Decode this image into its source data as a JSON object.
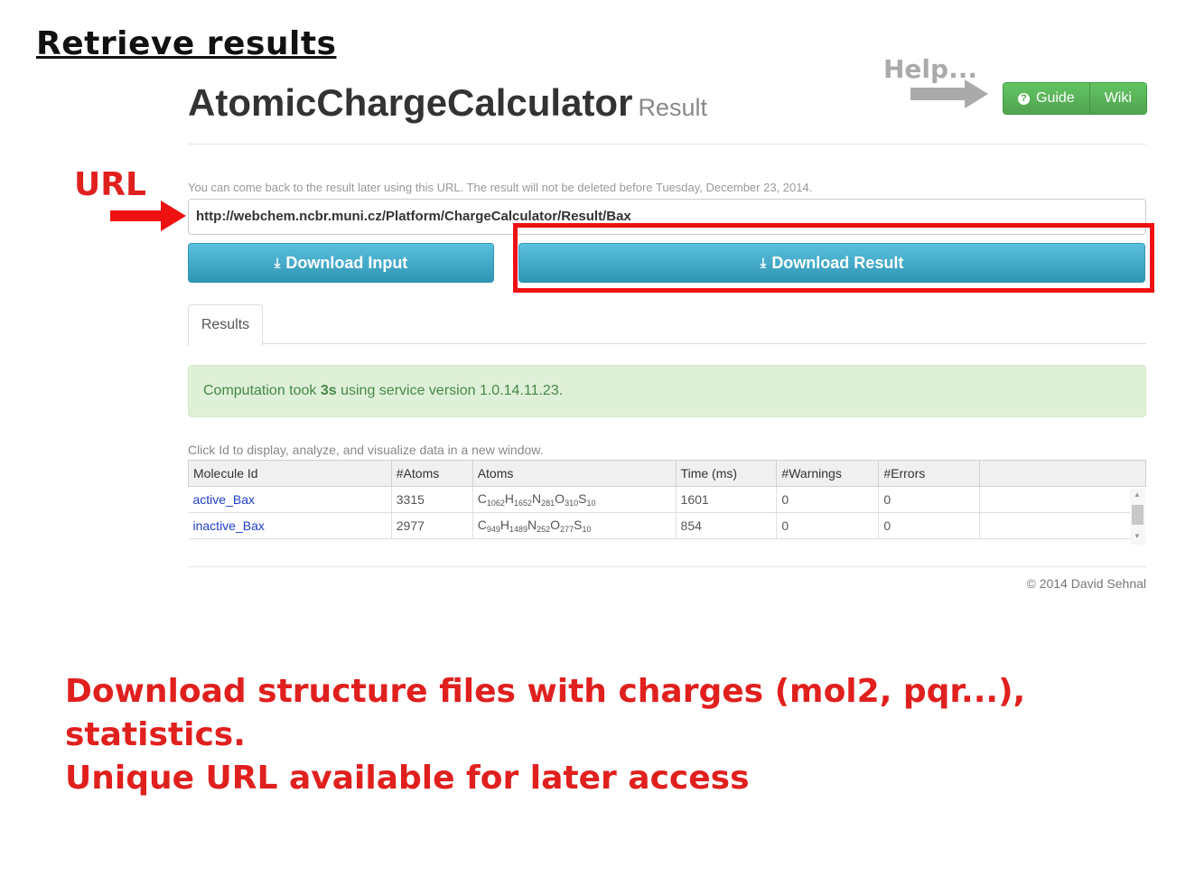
{
  "slide": {
    "title": "Retrieve results",
    "help_label": "Help...",
    "url_label": "URL",
    "caption_line1": "Download structure files with charges (mol2, pqr...), statistics.",
    "caption_line2": "Unique URL available for later access"
  },
  "header": {
    "app_name": "AtomicChargeCalculator",
    "page_label": "Result",
    "guide_label": "Guide",
    "wiki_label": "Wiki"
  },
  "result": {
    "info_text": "You can come back to the result later using this URL. The result will not be deleted before Tuesday, December 23, 2014.",
    "url": "http://webchem.ncbr.muni.cz/Platform/ChargeCalculator/Result/Bax",
    "download_input_label": "Download Input",
    "download_result_label": "Download Result"
  },
  "tabs": {
    "results_label": "Results"
  },
  "alert": {
    "prefix": "Computation took ",
    "time": "3s",
    "suffix": " using service version 1.0.14.11.23."
  },
  "table": {
    "hint": "Click Id to display, analyze, and visualize data in a new window.",
    "headers": [
      "Molecule Id",
      "#Atoms",
      "Atoms",
      "Time (ms)",
      "#Warnings",
      "#Errors"
    ],
    "rows": [
      {
        "id": "active_Bax",
        "atoms": "3315",
        "formula": [
          [
            "C",
            "1062"
          ],
          [
            "H",
            "1652"
          ],
          [
            "N",
            "281"
          ],
          [
            "O",
            "310"
          ],
          [
            "S",
            "10"
          ]
        ],
        "time": "1601",
        "warnings": "0",
        "errors": "0"
      },
      {
        "id": "inactive_Bax",
        "atoms": "2977",
        "formula": [
          [
            "C",
            "949"
          ],
          [
            "H",
            "1489"
          ],
          [
            "N",
            "252"
          ],
          [
            "O",
            "277"
          ],
          [
            "S",
            "10"
          ]
        ],
        "time": "854",
        "warnings": "0",
        "errors": "0"
      }
    ]
  },
  "footer": {
    "copyright": "© 2014 David Sehnal"
  },
  "colors": {
    "accent_red": "#e0201e",
    "button_blue": "#2f96b4",
    "button_green": "#51a351",
    "alert_green": "#dff0d8"
  },
  "icons": {
    "help_arrow": "right-arrow-icon",
    "url_arrow": "right-arrow-icon",
    "download": "download-icon",
    "guide": "question-circle-icon"
  }
}
